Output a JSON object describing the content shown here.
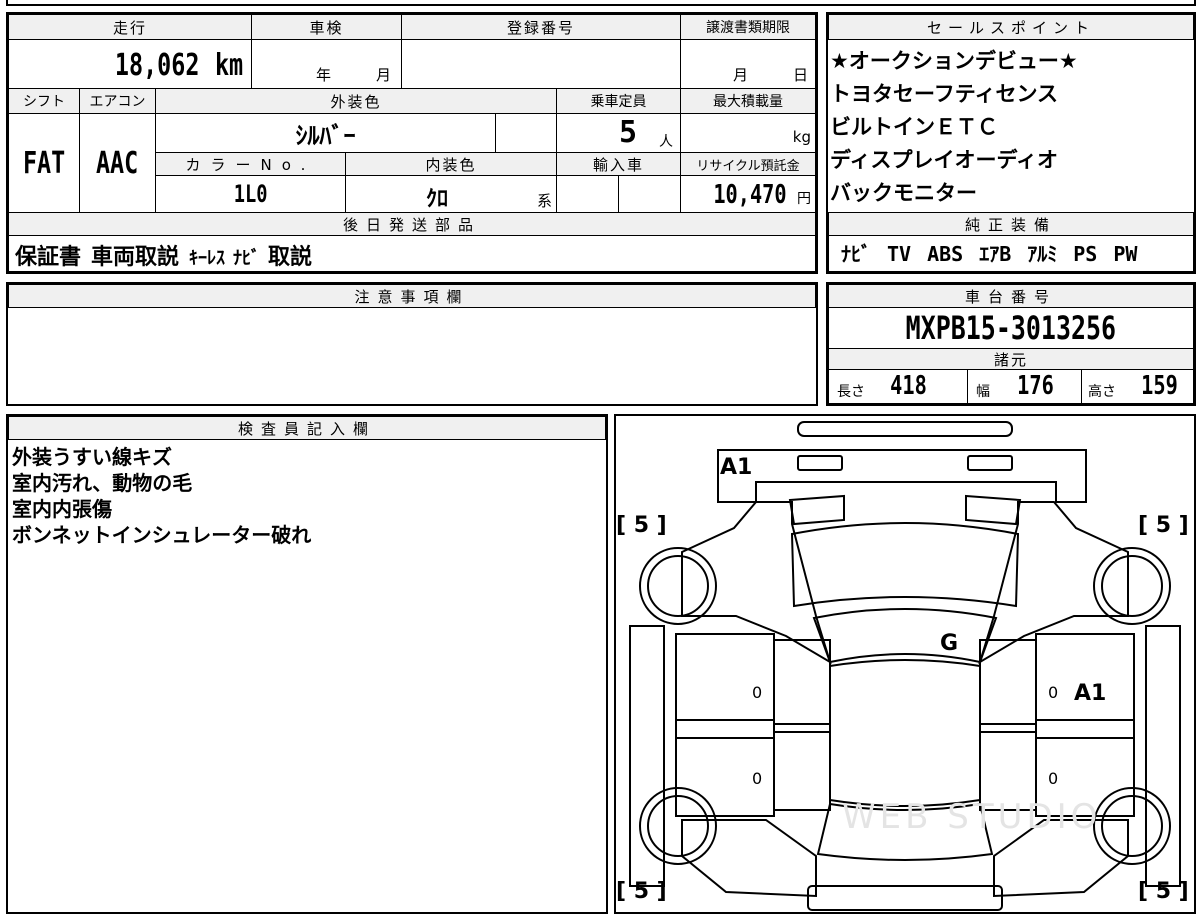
{
  "top_header": {
    "mileage_label": "走行",
    "inspection_label": "車検",
    "reg_label": "登録番号",
    "transfer_label": "譲渡書類期限"
  },
  "top_values": {
    "mileage": "18,062",
    "mileage_unit": "km",
    "year_unit": "年",
    "month_unit": "月",
    "transfer_month": "月",
    "transfer_day": "日"
  },
  "row2_header": {
    "shift_label": "シフト",
    "ac_label": "エアコン",
    "exterior_label": "外装色",
    "capacity_label": "乗車定員",
    "max_load_label": "最大積載量"
  },
  "row2_values": {
    "shift": "FAT",
    "ac": "AAC",
    "exterior": "ｼﾙﾊﾞｰ",
    "capacity": "5",
    "capacity_unit": "人",
    "load_unit": "kg"
  },
  "row3_header": {
    "color_no_label": "カラーNo.",
    "interior_label": "内装色",
    "import_label": "輸入車",
    "recycle_label": "リサイクル預託金"
  },
  "row3_values": {
    "color_no": "1L0",
    "interior": "ｸﾛ",
    "interior_suffix": "系",
    "recycle": "10,470",
    "recycle_unit": "円"
  },
  "later_parts": {
    "label": "後日発送部品",
    "items": [
      {
        "text": "保証書",
        "narrow": false
      },
      {
        "text": "車両取説",
        "narrow": false
      },
      {
        "text": "ｷｰﾚｽ",
        "narrow": true
      },
      {
        "text": "ﾅﾋﾞ",
        "narrow": true
      },
      {
        "text": "取説",
        "narrow": false
      }
    ]
  },
  "sales_points": {
    "label": "セールスポイント",
    "items": [
      "★オークションデビュー★",
      "トヨタセーフティセンス",
      "ビルトインＥＴＣ",
      "ディスプレイオーディオ",
      "バックモニター"
    ]
  },
  "genuine_equipment": {
    "label": "純正装備",
    "items": [
      "ﾅﾋﾞ",
      "TV",
      "ABS",
      "ｴｱB",
      "ｱﾙﾐ",
      "PS",
      "PW"
    ]
  },
  "notes": {
    "label": "注意事項欄"
  },
  "chassis": {
    "label": "車台番号",
    "number": "MXPB15-3013256",
    "spec_label": "諸元",
    "length_label": "長さ",
    "length": "418",
    "width_label": "幅",
    "width": "176",
    "height_label": "高さ",
    "height": "159"
  },
  "inspector": {
    "label": "検査員記入欄",
    "lines": [
      "外装うすい線キズ",
      "室内汚れ、動物の毛",
      "室内内張傷",
      "ボンネットインシュレーター破れ"
    ]
  },
  "diagram": {
    "tire_fl": "[ 5 ]",
    "tire_fr": "[ 5 ]",
    "tire_rl": "[ 5 ]",
    "tire_rr": "[ 5 ]",
    "mark_front": "A1",
    "mark_right_door": "A1",
    "mark_glass": "G",
    "mark_left_front_door": "0",
    "mark_left_rear_door": "0",
    "mark_right_front_door": "0",
    "mark_right_rear_door": "0",
    "watermark": "WEB STUDIO"
  }
}
